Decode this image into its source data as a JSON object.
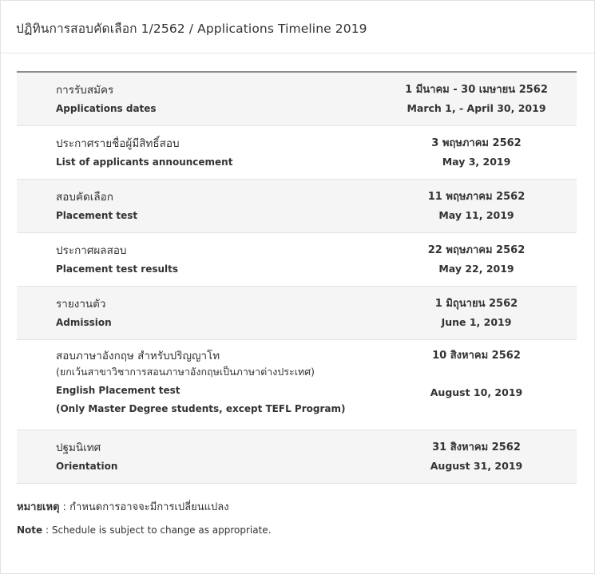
{
  "title": "ปฏิทินการสอบคัดเลือก 1/2562 / Applications Timeline 2019",
  "rows": [
    {
      "label_th": "การรับสมัคร",
      "label_en": "Applications dates",
      "date_th": "1 มีนาคม - 30 เมษายน 2562",
      "date_en": "March 1, - April 30, 2019"
    },
    {
      "label_th": "ประกาศรายชื่อผู้มีสิทธิ์สอบ",
      "label_en": "List of applicants announcement",
      "date_th": "3 พฤษภาคม 2562",
      "date_en": "May 3, 2019"
    },
    {
      "label_th": "สอบคัดเลือก",
      "label_en": "Placement test",
      "date_th": "11 พฤษภาคม 2562",
      "date_en": "May 11, 2019"
    },
    {
      "label_th": "ประกาศผลสอบ",
      "label_en": "Placement test results",
      "date_th": "22 พฤษภาคม 2562",
      "date_en": "May 22, 2019"
    },
    {
      "label_th": "รายงานตัว",
      "label_en": "Admission",
      "date_th": "1 มิถุนายน 2562",
      "date_en": "June 1, 2019"
    },
    {
      "label_th": "สอบภาษาอังกฤษ สำหรับปริญญาโท",
      "label_th_note": "(ยกเว้นสาขาวิชาการสอนภาษาอังกฤษเป็นภาษาต่างประเทศ)",
      "label_en": "English Placement test",
      "label_en_note": "(Only Master Degree students, except TEFL Program)",
      "date_th": "10 สิงหาคม 2562",
      "date_en": "August 10, 2019"
    },
    {
      "label_th": "ปฐมนิเทศ",
      "label_en": "Orientation",
      "date_th": "31 สิงหาคม 2562",
      "date_en": "August 31, 2019"
    }
  ],
  "notes": {
    "th_label": "หมายเหตุ",
    "th_text": " : กำหนดการอาจจะมีการเปลี่ยนแปลง",
    "en_label": "Note",
    "en_text": " : Schedule is subject to change as appropriate."
  },
  "colors": {
    "row_shaded": "#f5f5f5",
    "top_rule": "#8a8a8a",
    "divider": "#e3e3e3"
  }
}
